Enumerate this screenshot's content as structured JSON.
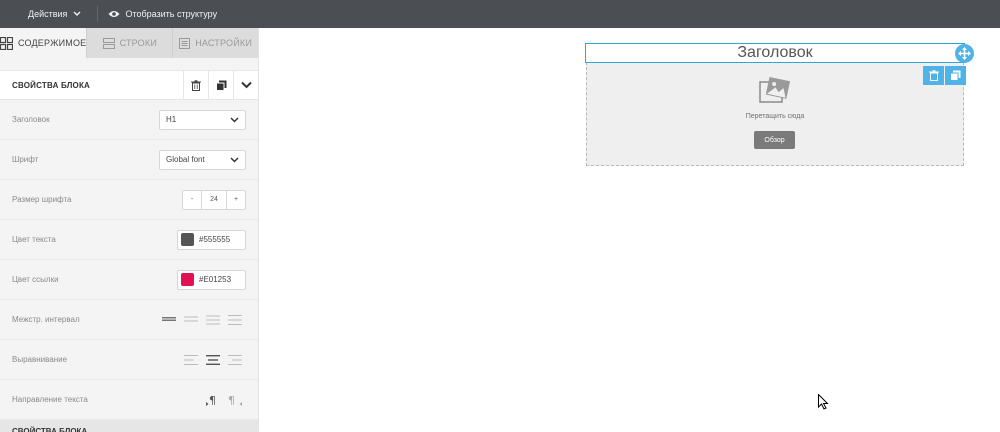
{
  "topbar": {
    "actions_label": "Действия",
    "structure_label": "Отобразить структуру"
  },
  "tabs": [
    {
      "label": "СОДЕРЖИМОЕ",
      "icon": "content-grid-icon",
      "active": true
    },
    {
      "label": "СТРОКИ",
      "icon": "rows-icon",
      "active": false
    },
    {
      "label": "НАСТРОЙКИ",
      "icon": "settings-icon",
      "active": false
    }
  ],
  "props": {
    "title": "СВОЙСТВА БЛОКА",
    "heading": {
      "label": "Заголовок",
      "value": "H1"
    },
    "font": {
      "label": "Шрифт",
      "value": "Global font"
    },
    "font_size": {
      "label": "Размер шрифта",
      "minus": "-",
      "value": "24",
      "plus": "+"
    },
    "text_color": {
      "label": "Цвет текста",
      "value": "#555555",
      "swatch": "#555555"
    },
    "link_color": {
      "label": "Цвет ссылки",
      "value": "#E01253",
      "swatch": "#E01253"
    },
    "line_height": {
      "label": "Межстр. интервал"
    },
    "align": {
      "label": "Выравнивание"
    },
    "direction": {
      "label": "Направление текста"
    },
    "footer": "СВОЙСТВА БЛОКА"
  },
  "canvas": {
    "heading_text": "Заголовок",
    "drop_text": "Перетащить сюда",
    "browse_label": "Обзор"
  },
  "colors": {
    "accent": "#4fb3e8",
    "topbar": "#4b4f54"
  }
}
